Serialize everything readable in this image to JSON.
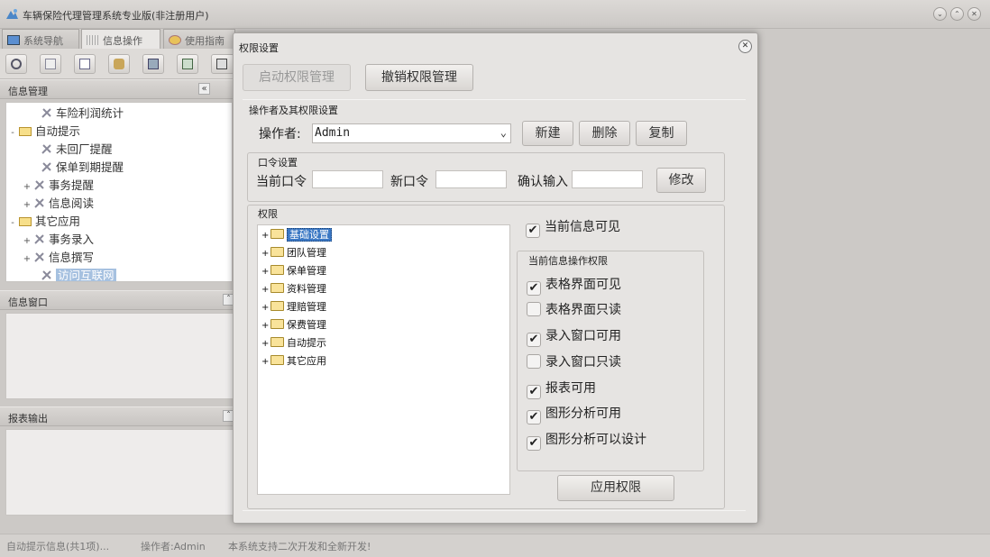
{
  "app": {
    "title": "车辆保险代理管理系统专业版(非注册用户)"
  },
  "tabs": [
    {
      "label": "系统导航"
    },
    {
      "label": "信息操作"
    },
    {
      "label": "使用指南"
    }
  ],
  "panels": {
    "info_manage": "信息管理",
    "info_window": "信息窗口",
    "report_output": "报表输出"
  },
  "left_tree": {
    "items": [
      {
        "label": "车险利润统计",
        "expander": ""
      },
      {
        "label": "自动提示",
        "expander": "-"
      },
      {
        "label": "未回厂提醒",
        "expander": ""
      },
      {
        "label": "保单到期提醒",
        "expander": ""
      },
      {
        "label": "事务提醒",
        "expander": "+"
      },
      {
        "label": "信息阅读",
        "expander": "+"
      },
      {
        "label": "其它应用",
        "expander": "-"
      },
      {
        "label": "事务录入",
        "expander": "+"
      },
      {
        "label": "信息撰写",
        "expander": "+"
      },
      {
        "label": "访问互联网",
        "expander": ""
      }
    ]
  },
  "statusbar": {
    "auto_tip": "自动提示信息(共1项)...",
    "operator": "操作者:Admin",
    "notice": "本系统支持二次开发和全新开发!"
  },
  "dialog": {
    "title": "权限设置",
    "enable_btn": "启动权限管理",
    "revoke_btn": "撤销权限管理",
    "operator_group": "操作者及其权限设置",
    "operator_label": "操作者:",
    "operator_value": "Admin",
    "new_btn": "新建",
    "delete_btn": "删除",
    "copy_btn": "复制",
    "password_group": "口令设置",
    "current_pw": "当前口令",
    "new_pw": "新口令",
    "confirm_pw": "确认输入",
    "modify_btn": "修改",
    "perm_group": "权限",
    "perm_tree": [
      {
        "label": "基础设置"
      },
      {
        "label": "团队管理"
      },
      {
        "label": "保单管理"
      },
      {
        "label": "资料管理"
      },
      {
        "label": "理赔管理"
      },
      {
        "label": "保费管理"
      },
      {
        "label": "自动提示"
      },
      {
        "label": "其它应用"
      }
    ],
    "visible_check": {
      "label": "当前信息可见",
      "checked": true
    },
    "ops_group": "当前信息操作权限",
    "ops": [
      {
        "label": "表格界面可见",
        "checked": true
      },
      {
        "label": "表格界面只读",
        "checked": false
      },
      {
        "label": "录入窗口可用",
        "checked": true
      },
      {
        "label": "录入窗口只读",
        "checked": false
      },
      {
        "label": "报表可用",
        "checked": true
      },
      {
        "label": "图形分析可用",
        "checked": true
      },
      {
        "label": "图形分析可以设计",
        "checked": true
      }
    ],
    "apply_btn": "应用权限"
  }
}
